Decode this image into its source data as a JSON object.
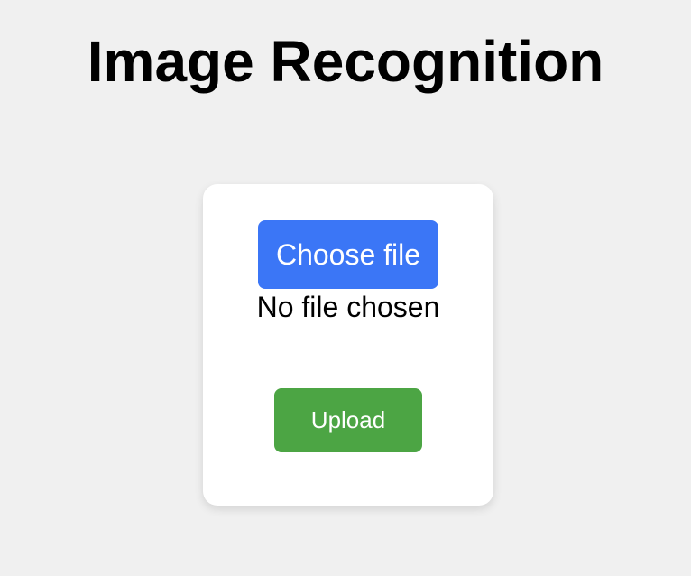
{
  "page": {
    "title": "Image Recognition"
  },
  "upload_form": {
    "choose_file_label": "Choose file",
    "file_status": "No file chosen",
    "upload_label": "Upload"
  },
  "colors": {
    "background": "#f0f0f0",
    "card": "#ffffff",
    "choose_button": "#3b76f6",
    "upload_button": "#4ca544"
  }
}
